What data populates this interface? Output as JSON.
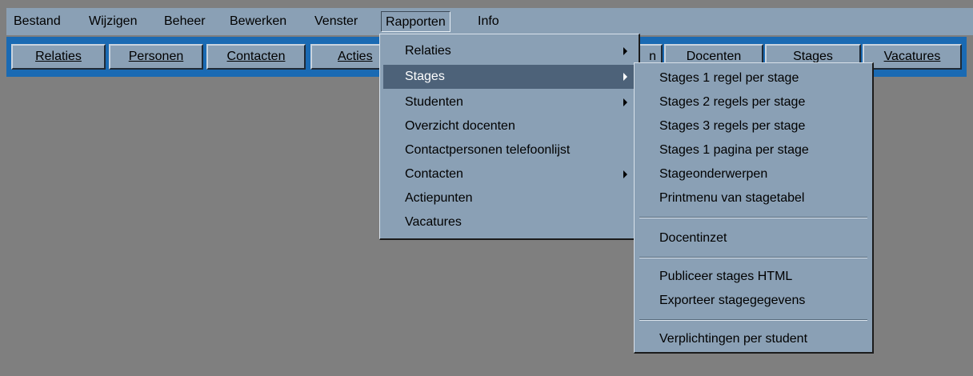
{
  "menubar": {
    "items": [
      "Bestand",
      "Wijzigen",
      "Beheer",
      "Bewerken",
      "Venster",
      "Rapporten",
      "Info"
    ]
  },
  "toolbar": {
    "relaties": "Relaties",
    "personen": "Personen",
    "contacten": "Contacten",
    "acties": "Acties",
    "hidden_fragment": "n",
    "docenten": "Docenten",
    "stages": "Stages",
    "vacatures": "Vacatures"
  },
  "rapporten_menu": {
    "items": [
      "Relaties",
      "Stages",
      "Studenten",
      "Overzicht docenten",
      "Contactpersonen telefoonlijst",
      "Contacten",
      "Actiepunten",
      "Vacatures"
    ]
  },
  "stages_submenu": {
    "items": [
      "Stages 1 regel per stage",
      "Stages 2 regels per stage",
      "Stages 3 regels per stage",
      "Stages 1 pagina per stage",
      "Stageonderwerpen",
      "Printmenu van stagetabel",
      "Docentinzet",
      "Publiceer stages HTML",
      "Exporteer stagegegevens",
      "Verplichtingen per student"
    ]
  },
  "colors": {
    "workspace": "#7f7f7f",
    "menubar": "#8aa0b5",
    "toolbar": "#1a6ab3",
    "highlight": "#4d6279"
  }
}
